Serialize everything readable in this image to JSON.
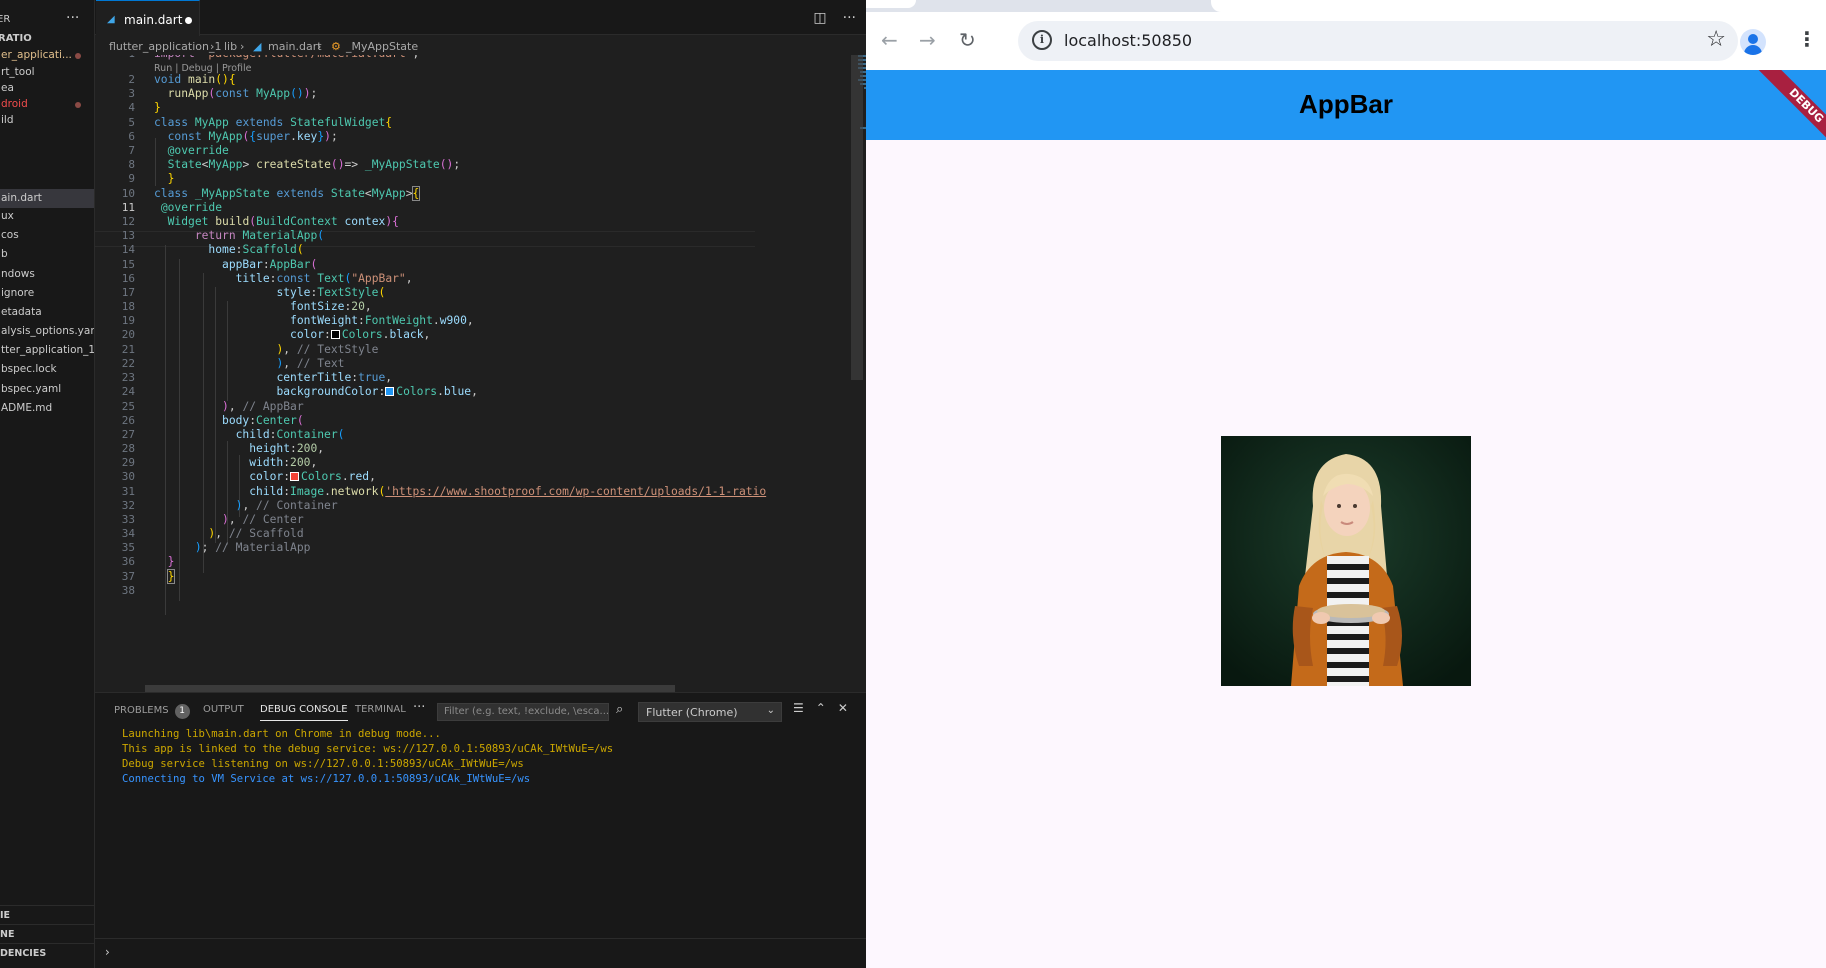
{
  "vscode": {
    "explorer": {
      "header": "ER",
      "more": "···",
      "section": "RATIO",
      "items": [
        {
          "label": "er_applicati...",
          "state": "modified-error"
        },
        {
          "label": "rt_tool",
          "state": ""
        },
        {
          "label": "ea",
          "state": ""
        },
        {
          "label": "droid",
          "state": "error"
        },
        {
          "label": "ild",
          "state": ""
        },
        {
          "label": "ain.dart",
          "state": "selected"
        },
        {
          "label": "ux",
          "state": ""
        },
        {
          "label": "cos",
          "state": ""
        },
        {
          "label": "b",
          "state": ""
        },
        {
          "label": "ndows",
          "state": ""
        },
        {
          "label": "ignore",
          "state": ""
        },
        {
          "label": "etadata",
          "state": ""
        },
        {
          "label": "alysis_options.yaml",
          "state": ""
        },
        {
          "label": "tter_application_1...",
          "state": ""
        },
        {
          "label": "bspec.lock",
          "state": ""
        },
        {
          "label": "bspec.yaml",
          "state": ""
        },
        {
          "label": "ADME.md",
          "state": ""
        }
      ],
      "bottom_sections": [
        "IE",
        "NE",
        "DENCIES"
      ]
    },
    "tab": {
      "label": "main.dart"
    },
    "breadcrumb": {
      "project": "flutter_application_1",
      "sep": "›",
      "folder": "lib",
      "file": "main.dart",
      "symbol": "_MyAppState"
    },
    "codelens": "Run | Debug | Profile",
    "line_numbers": [
      "1",
      "2",
      "3",
      "4",
      "5",
      "6",
      "7",
      "8",
      "9",
      "10",
      "11",
      "12",
      "13",
      "14",
      "15",
      "16",
      "17",
      "18",
      "19",
      "20",
      "21",
      "22",
      "23",
      "24",
      "25",
      "26",
      "27",
      "28",
      "29",
      "30",
      "31",
      "32",
      "33",
      "34",
      "35",
      "36",
      "37",
      "38"
    ],
    "current_line": 11,
    "panel": {
      "tabs": {
        "problems": "PROBLEMS",
        "problems_count": "1",
        "output": "OUTPUT",
        "debug_console": "DEBUG CONSOLE",
        "terminal": "TERMINAL",
        "more": "···"
      },
      "filter_placeholder": "Filter (e.g. text, !exclude, \\esca...",
      "session": "Flutter (Chrome)",
      "output_lines": [
        "Launching lib\\main.dart on Chrome in debug mode...",
        "This app is linked to the debug service: ws://127.0.0.1:50893/uCAk_IWtWuE=/ws",
        "Debug service listening on ws://127.0.0.1:50893/uCAk_IWtWuE=/ws",
        "Connecting to VM Service at ws://127.0.0.1:50893/uCAk_IWtWuE=/ws"
      ],
      "prompt": "›"
    }
  },
  "browser": {
    "url": "localhost:50850",
    "appbar_title": "AppBar",
    "debug_banner": "DEBUG",
    "colors": {
      "appbar": "#2196f3",
      "banner": "#a82040",
      "body": "#fdf7fe"
    }
  }
}
